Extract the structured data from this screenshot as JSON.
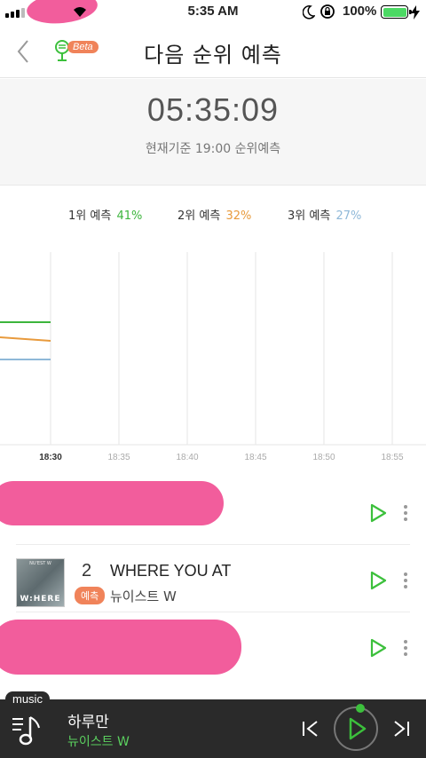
{
  "status_bar": {
    "time": "5:35 AM",
    "battery": "100%"
  },
  "header": {
    "title": "다음 순위 예측",
    "beta_label": "Beta"
  },
  "timer": {
    "clock": "05:35:09",
    "caption": "현재기준 19:00 순위예측"
  },
  "legend": [
    {
      "label": "1위 예측",
      "pct": "41%",
      "color": "#3cb53c"
    },
    {
      "label": "2위 예측",
      "pct": "32%",
      "color": "#e89a3c"
    },
    {
      "label": "3위 예측",
      "pct": "27%",
      "color": "#8fb8d8"
    }
  ],
  "chart_data": {
    "type": "line",
    "x": [
      "18:30",
      "18:35",
      "18:40",
      "18:45",
      "18:50",
      "18:55"
    ],
    "series": [
      {
        "name": "1위 예측",
        "color": "#3cb53c",
        "values": [
          41
        ]
      },
      {
        "name": "2위 예측",
        "color": "#e89a3c",
        "values": [
          32
        ]
      },
      {
        "name": "3위 예측",
        "color": "#8fb8d8",
        "values": [
          27
        ]
      }
    ],
    "grid": true
  },
  "songs": [
    {
      "redacted": true
    },
    {
      "rank": "2",
      "title": "WHERE YOU AT",
      "artist": "뉴이스트 W",
      "badge": "예측",
      "album_text": "W:HERE"
    },
    {
      "redacted": true
    }
  ],
  "player": {
    "tag": "music",
    "title": "하루만",
    "artist": "뉴이스트 W"
  },
  "colors": {
    "accent_green": "#3cc03c",
    "badge_orange": "#f0835a",
    "redaction_pink": "#f25d9c"
  }
}
